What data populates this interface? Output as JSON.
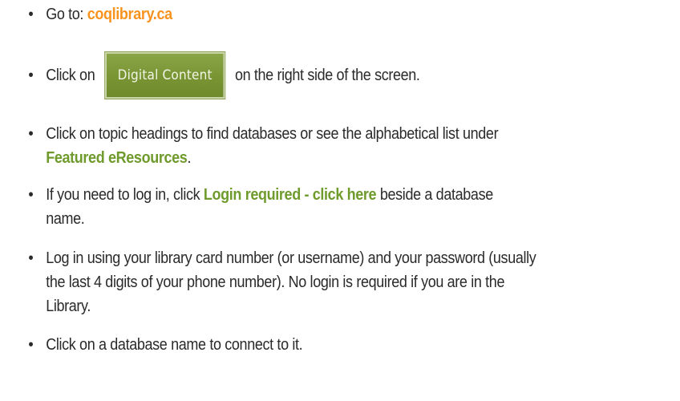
{
  "bullet_char": "•",
  "items": [
    {
      "prefix": "Go to: ",
      "link": "coqlibrary.ca"
    },
    {
      "prefix": "Click on",
      "button_label": "Digital Content",
      "suffix": "on the right side of the screen."
    },
    {
      "line1": "Click on topic headings to find databases or see the alphabetical list under",
      "bold": "Featured eResources",
      "suffix": "."
    },
    {
      "prefix": "If you need to log in, click ",
      "bold": "Login required - click here",
      "suffix_line1": " beside a database",
      "suffix_line2": "name."
    },
    {
      "line1": "Log in using your library card number (or username) and your password (usually",
      "line2": "the last 4 digits of your phone number). No login is required if you are in the",
      "line3": "Library."
    },
    {
      "text": "Click on a database name to connect to it."
    }
  ],
  "colors": {
    "link": "#f7931e",
    "accent_green": "#6f9a2c",
    "button_green": "#7a9636"
  }
}
